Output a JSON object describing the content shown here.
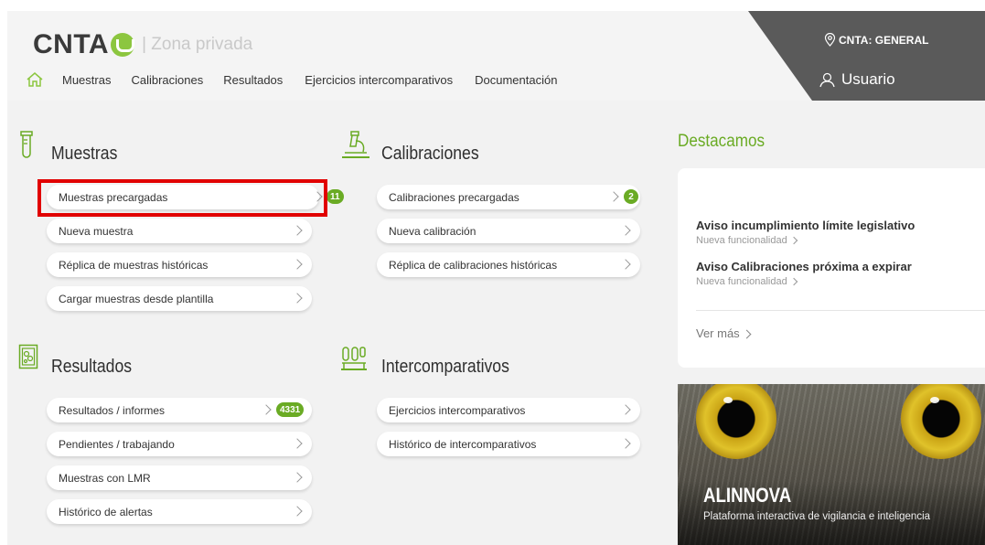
{
  "header": {
    "logo_text": "CNTA",
    "zone_label": "| Zona privada",
    "center_label": "CNTA: GENERAL",
    "user_label": "Usuario",
    "nav": [
      "Muestras",
      "Calibraciones",
      "Resultados",
      "Ejercicios intercomparativos",
      "Documentación"
    ]
  },
  "sections": {
    "muestras": {
      "title": "Muestras",
      "items": [
        {
          "label": "Muestras precargadas",
          "badge": "11"
        },
        {
          "label": "Nueva muestra"
        },
        {
          "label": "Réplica de muestras históricas"
        },
        {
          "label": "Cargar muestras desde plantilla"
        }
      ]
    },
    "calibraciones": {
      "title": "Calibraciones",
      "items": [
        {
          "label": "Calibraciones precargadas",
          "badge": "2"
        },
        {
          "label": "Nueva calibración"
        },
        {
          "label": "Réplica de calibraciones históricas"
        }
      ]
    },
    "resultados": {
      "title": "Resultados",
      "items": [
        {
          "label": "Resultados / informes",
          "badge": "4331"
        },
        {
          "label": "Pendientes / trabajando"
        },
        {
          "label": "Muestras con LMR"
        },
        {
          "label": "Histórico de alertas"
        }
      ]
    },
    "intercomparativos": {
      "title": "Intercomparativos",
      "items": [
        {
          "label": "Ejercicios intercomparativos"
        },
        {
          "label": "Histórico de intercomparativos"
        }
      ]
    }
  },
  "destacamos": {
    "title": "Destacamos",
    "news": [
      {
        "title": "Aviso incumplimiento límite legislativo",
        "subtitle": "Nueva funcionalidad"
      },
      {
        "title": "Aviso Calibraciones próxima a expirar",
        "subtitle": "Nueva funcionalidad"
      }
    ],
    "more_label": "Ver más"
  },
  "banner": {
    "title": "ALINNOVA",
    "subtitle": "Plataforma interactiva de vigilancia e inteligencia"
  },
  "colors": {
    "accent": "#6aab24",
    "highlight": "#e10000",
    "header_dark": "#5a5a5a"
  },
  "icons": [
    "home-icon",
    "location-pin-icon",
    "user-icon",
    "test-tube-icon",
    "microscope-icon",
    "report-icon",
    "lab-equipment-icon",
    "chevron-right-icon"
  ]
}
